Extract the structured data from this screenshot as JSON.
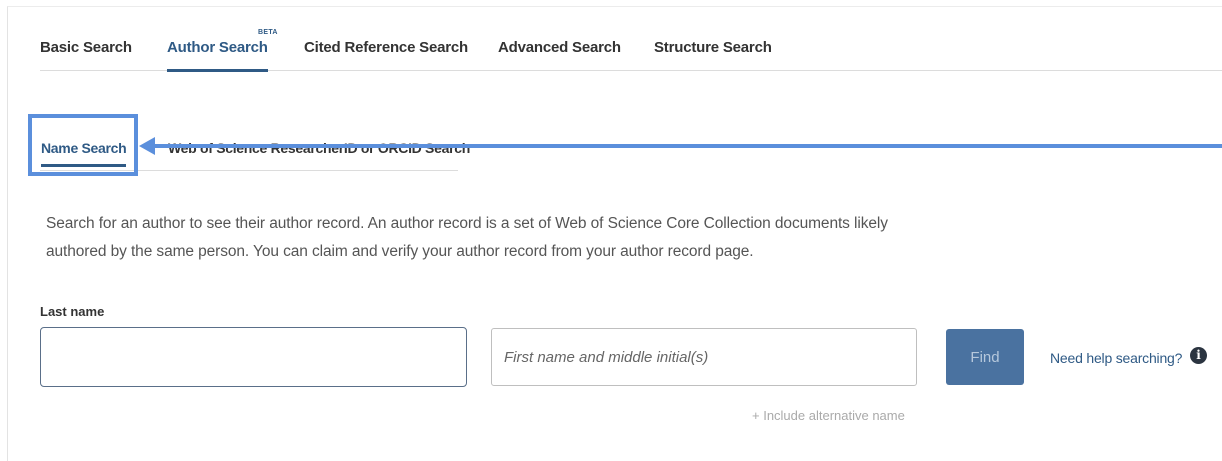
{
  "top_tabs": {
    "basic": "Basic Search",
    "author": "Author Search",
    "author_badge": "BETA",
    "cited": "Cited Reference Search",
    "advanced": "Advanced Search",
    "structure": "Structure Search"
  },
  "sub_tabs": {
    "name": "Name Search",
    "researcher_id": "Web of Science ResearcherID or ORCID Search"
  },
  "description": "Search for an author to see their author record. An author record is a set of Web of Science Core Collection documents likely authored by the same person. You can claim and verify your author record from your author record page.",
  "form": {
    "last_name_label": "Last name",
    "last_name_value": "",
    "first_name_placeholder": "First name and middle initial(s)",
    "find_label": "Find",
    "help_label": "Need help searching?",
    "alt_name_label": "+ Include alternative name"
  },
  "colors": {
    "accent": "#2f5a85",
    "annotation": "#5b8fdc",
    "button": "#4a72a0"
  },
  "icons": [
    "info-icon",
    "annotation-arrow"
  ]
}
